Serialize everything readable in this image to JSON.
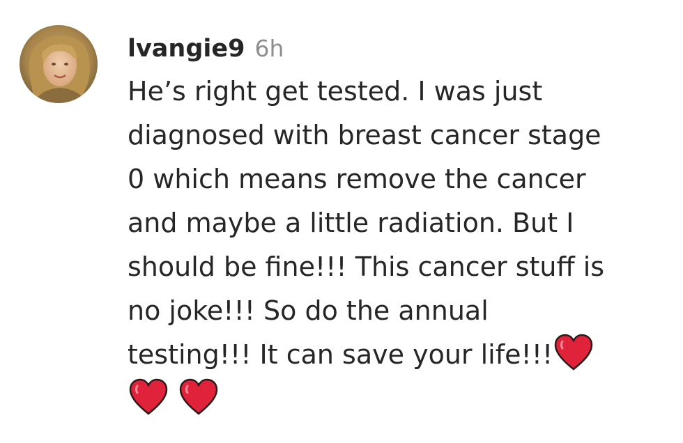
{
  "comment": {
    "username": "lvangie9",
    "timestamp": "6h",
    "lines": [
      "He’s right get tested. I was just",
      "diagnosed with breast cancer stage",
      "0 which means remove the cancer",
      "and maybe a little radiation. But I",
      "should be fine!!! This cancer stuff is",
      "no joke!!! So do the annual",
      "testing!!! It can save your life!!!"
    ],
    "emojis": [
      "heart-icon",
      "heart-icon",
      "heart-icon"
    ]
  },
  "colors": {
    "text": "#262626",
    "muted": "#8e8e8e",
    "heart": "#e0233a"
  }
}
